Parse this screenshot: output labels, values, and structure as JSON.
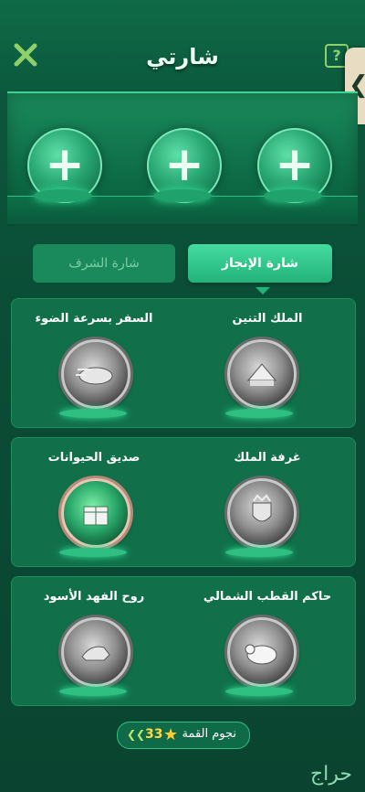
{
  "header": {
    "title": "شارتي",
    "help_label": "?",
    "close_icon": "close-x-icon",
    "side_arrow": "❮"
  },
  "showcase": {
    "slots": [
      "+",
      "+",
      "+"
    ]
  },
  "tabs": [
    {
      "label": "شارة الإنجاز",
      "active": true
    },
    {
      "label": "شارة الشرف",
      "active": false
    }
  ],
  "badges": [
    {
      "right": "الملك التنين",
      "left": "السفر بسرعة الضوء"
    },
    {
      "right": "غرفة الملك",
      "left": "صديق الحيوانات"
    },
    {
      "right": "حاكم القطب الشمالي",
      "left": "روح الفهد الأسود"
    }
  ],
  "footer": {
    "label": "نجوم القمة",
    "count": "33",
    "star": "★",
    "chevrons": "❮❮"
  },
  "watermark": "حراج",
  "colors": {
    "bg": "#0b4d36",
    "accent": "#22b37a",
    "gold": "#ffcc33"
  }
}
